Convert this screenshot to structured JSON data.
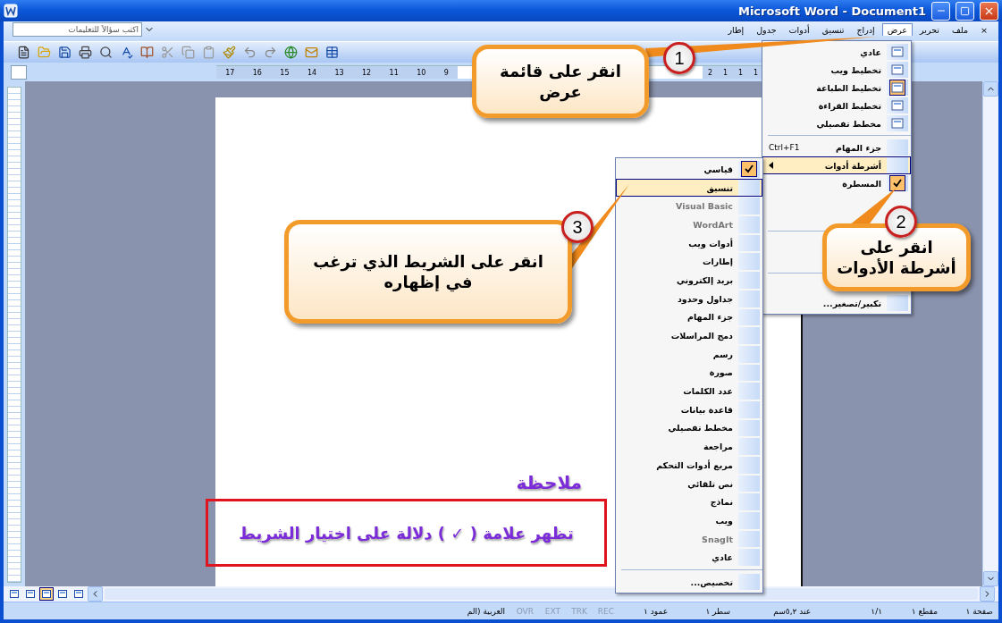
{
  "window": {
    "title": "Microsoft Word - Document1"
  },
  "help_box": {
    "placeholder": "اكتب سؤالاً للتعليمات"
  },
  "menu_bar": {
    "close_label": "×",
    "items": [
      {
        "label": "ملف",
        "selected": false
      },
      {
        "label": "تحرير",
        "selected": false
      },
      {
        "label": "عرض",
        "selected": true
      },
      {
        "label": "إدراج",
        "selected": false
      },
      {
        "label": "تنسيق",
        "selected": false
      },
      {
        "label": "أدوات",
        "selected": false
      },
      {
        "label": "جدول",
        "selected": false
      },
      {
        "label": "إطار",
        "selected": false
      }
    ]
  },
  "ruler": {
    "left_labels": [
      "9",
      "10",
      "11",
      "12",
      "13",
      "14",
      "15",
      "16",
      "17"
    ],
    "right_labels": [
      "1",
      "1",
      "1",
      "2"
    ]
  },
  "view_menu": [
    {
      "kind": "icon",
      "label": "عادي",
      "selected": false,
      "checked": false
    },
    {
      "kind": "icon",
      "label": "تخطيط ويب",
      "selected": false,
      "checked": false
    },
    {
      "kind": "icon",
      "label": "تخطيط الطباعة",
      "selected": false,
      "checked": true
    },
    {
      "kind": "icon",
      "label": "تخطيط القراءة",
      "selected": false,
      "checked": false
    },
    {
      "kind": "icon",
      "label": "مخطط تفصيلي",
      "selected": false,
      "checked": false
    },
    {
      "kind": "separator"
    },
    {
      "kind": "plain",
      "label": "جزء المهام",
      "shortcut": "Ctrl+F1",
      "selected": false,
      "checked": false
    },
    {
      "kind": "submenu",
      "label": "أشرطة أدوات",
      "selected": true,
      "checked": false
    },
    {
      "kind": "plain",
      "label": "المسطرة",
      "selected": false,
      "checked": true
    },
    {
      "kind": "covered"
    },
    {
      "kind": "covered"
    },
    {
      "kind": "separator"
    },
    {
      "kind": "covered"
    },
    {
      "kind": "covered"
    },
    {
      "kind": "separator"
    },
    {
      "kind": "covered"
    },
    {
      "kind": "plain",
      "label": "تكبير/تصغير...",
      "selected": false,
      "checked": false
    }
  ],
  "toolbars_menu": [
    {
      "label": "قياسي",
      "selected": false,
      "checked": true
    },
    {
      "label": "تنسيق",
      "selected": true,
      "checked": false
    },
    {
      "label": "Visual Basic",
      "selected": false,
      "checked": false
    },
    {
      "label": "WordArt",
      "selected": false,
      "checked": false
    },
    {
      "label": "أدوات ويب",
      "selected": false,
      "checked": false
    },
    {
      "label": "إطارات",
      "selected": false,
      "checked": false
    },
    {
      "label": "بريد إلكتروني",
      "selected": false,
      "checked": false
    },
    {
      "label": "جداول وحدود",
      "selected": false,
      "checked": false
    },
    {
      "label": "جزء المهام",
      "selected": false,
      "checked": false
    },
    {
      "label": "دمج المراسلات",
      "selected": false,
      "checked": false
    },
    {
      "label": "رسم",
      "selected": false,
      "checked": false
    },
    {
      "label": "صورة",
      "selected": false,
      "checked": false
    },
    {
      "label": "عدد الكلمات",
      "selected": false,
      "checked": false
    },
    {
      "label": "قاعدة بيانات",
      "selected": false,
      "checked": false
    },
    {
      "label": "مخطط تفصيلي",
      "selected": false,
      "checked": false
    },
    {
      "label": "مراجعة",
      "selected": false,
      "checked": false
    },
    {
      "label": "مربع أدوات التحكم",
      "selected": false,
      "checked": false
    },
    {
      "label": "نص تلقائي",
      "selected": false,
      "checked": false
    },
    {
      "label": "نماذج",
      "selected": false,
      "checked": false
    },
    {
      "label": "ويب",
      "selected": false,
      "checked": false
    },
    {
      "label": "SnagIt",
      "selected": false,
      "checked": false
    },
    {
      "label": "عادي",
      "selected": false,
      "checked": false
    }
  ],
  "toolbars_menu_footer": "تخصيص...",
  "callouts": [
    {
      "number": "1",
      "text": "انقر على قائمة\nعرض"
    },
    {
      "number": "2",
      "text": "انقر على\nأشرطة الأدوات"
    },
    {
      "number": "3",
      "text": "انقر على الشريط الذي ترغب\nفي إظهاره"
    }
  ],
  "note": {
    "title": "ملاحظة",
    "text": "تظهر علامة ( ✓ ) دلالة على اختيار الشريط"
  },
  "status_bar": [
    {
      "label": "صفحة ١",
      "disabled": false
    },
    {
      "label": "مقطع ١",
      "disabled": false
    },
    {
      "label": "١/١",
      "disabled": false
    },
    {
      "label": "عند ٥,٢سم",
      "disabled": false
    },
    {
      "label": "سطر ١",
      "disabled": false
    },
    {
      "label": "عمود ١",
      "disabled": false
    },
    {
      "label": "REC",
      "disabled": true
    },
    {
      "label": "TRK",
      "disabled": true
    },
    {
      "label": "EXT",
      "disabled": true
    },
    {
      "label": "OVR",
      "disabled": true
    },
    {
      "label": "العربية (الم",
      "disabled": false
    }
  ]
}
